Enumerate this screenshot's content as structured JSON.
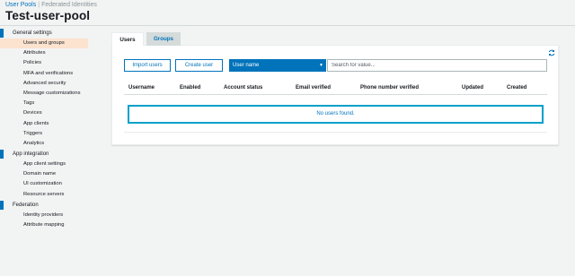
{
  "breadcrumb": {
    "user_pools": "User Pools",
    "federated": "Federated Identities"
  },
  "page_title": "Test-user-pool",
  "sidebar": {
    "sections": [
      {
        "label": "General settings",
        "items": [
          "Users and groups",
          "Attributes",
          "Policies",
          "MFA and verifications",
          "Advanced security",
          "Message customizations",
          "Tags",
          "Devices",
          "App clients",
          "Triggers",
          "Analytics"
        ]
      },
      {
        "label": "App integration",
        "items": [
          "App client settings",
          "Domain name",
          "UI customization",
          "Resource servers"
        ]
      },
      {
        "label": "Federation",
        "items": [
          "Identity providers",
          "Attribute mapping"
        ]
      }
    ],
    "active_item": "Users and groups"
  },
  "tabs": {
    "users": "Users",
    "groups": "Groups"
  },
  "toolbar": {
    "import_label": "Import users",
    "create_label": "Create user",
    "filter_selected": "User name",
    "search_placeholder": "Search for value..."
  },
  "table": {
    "headers": [
      "Username",
      "Enabled",
      "Account status",
      "Email verified",
      "Phone number verified",
      "Updated",
      "Created"
    ],
    "empty_message": "No users found."
  },
  "colors": {
    "accent": "#0073bb",
    "highlight": "#fbe3cf",
    "empty_border": "#00a1c9"
  }
}
